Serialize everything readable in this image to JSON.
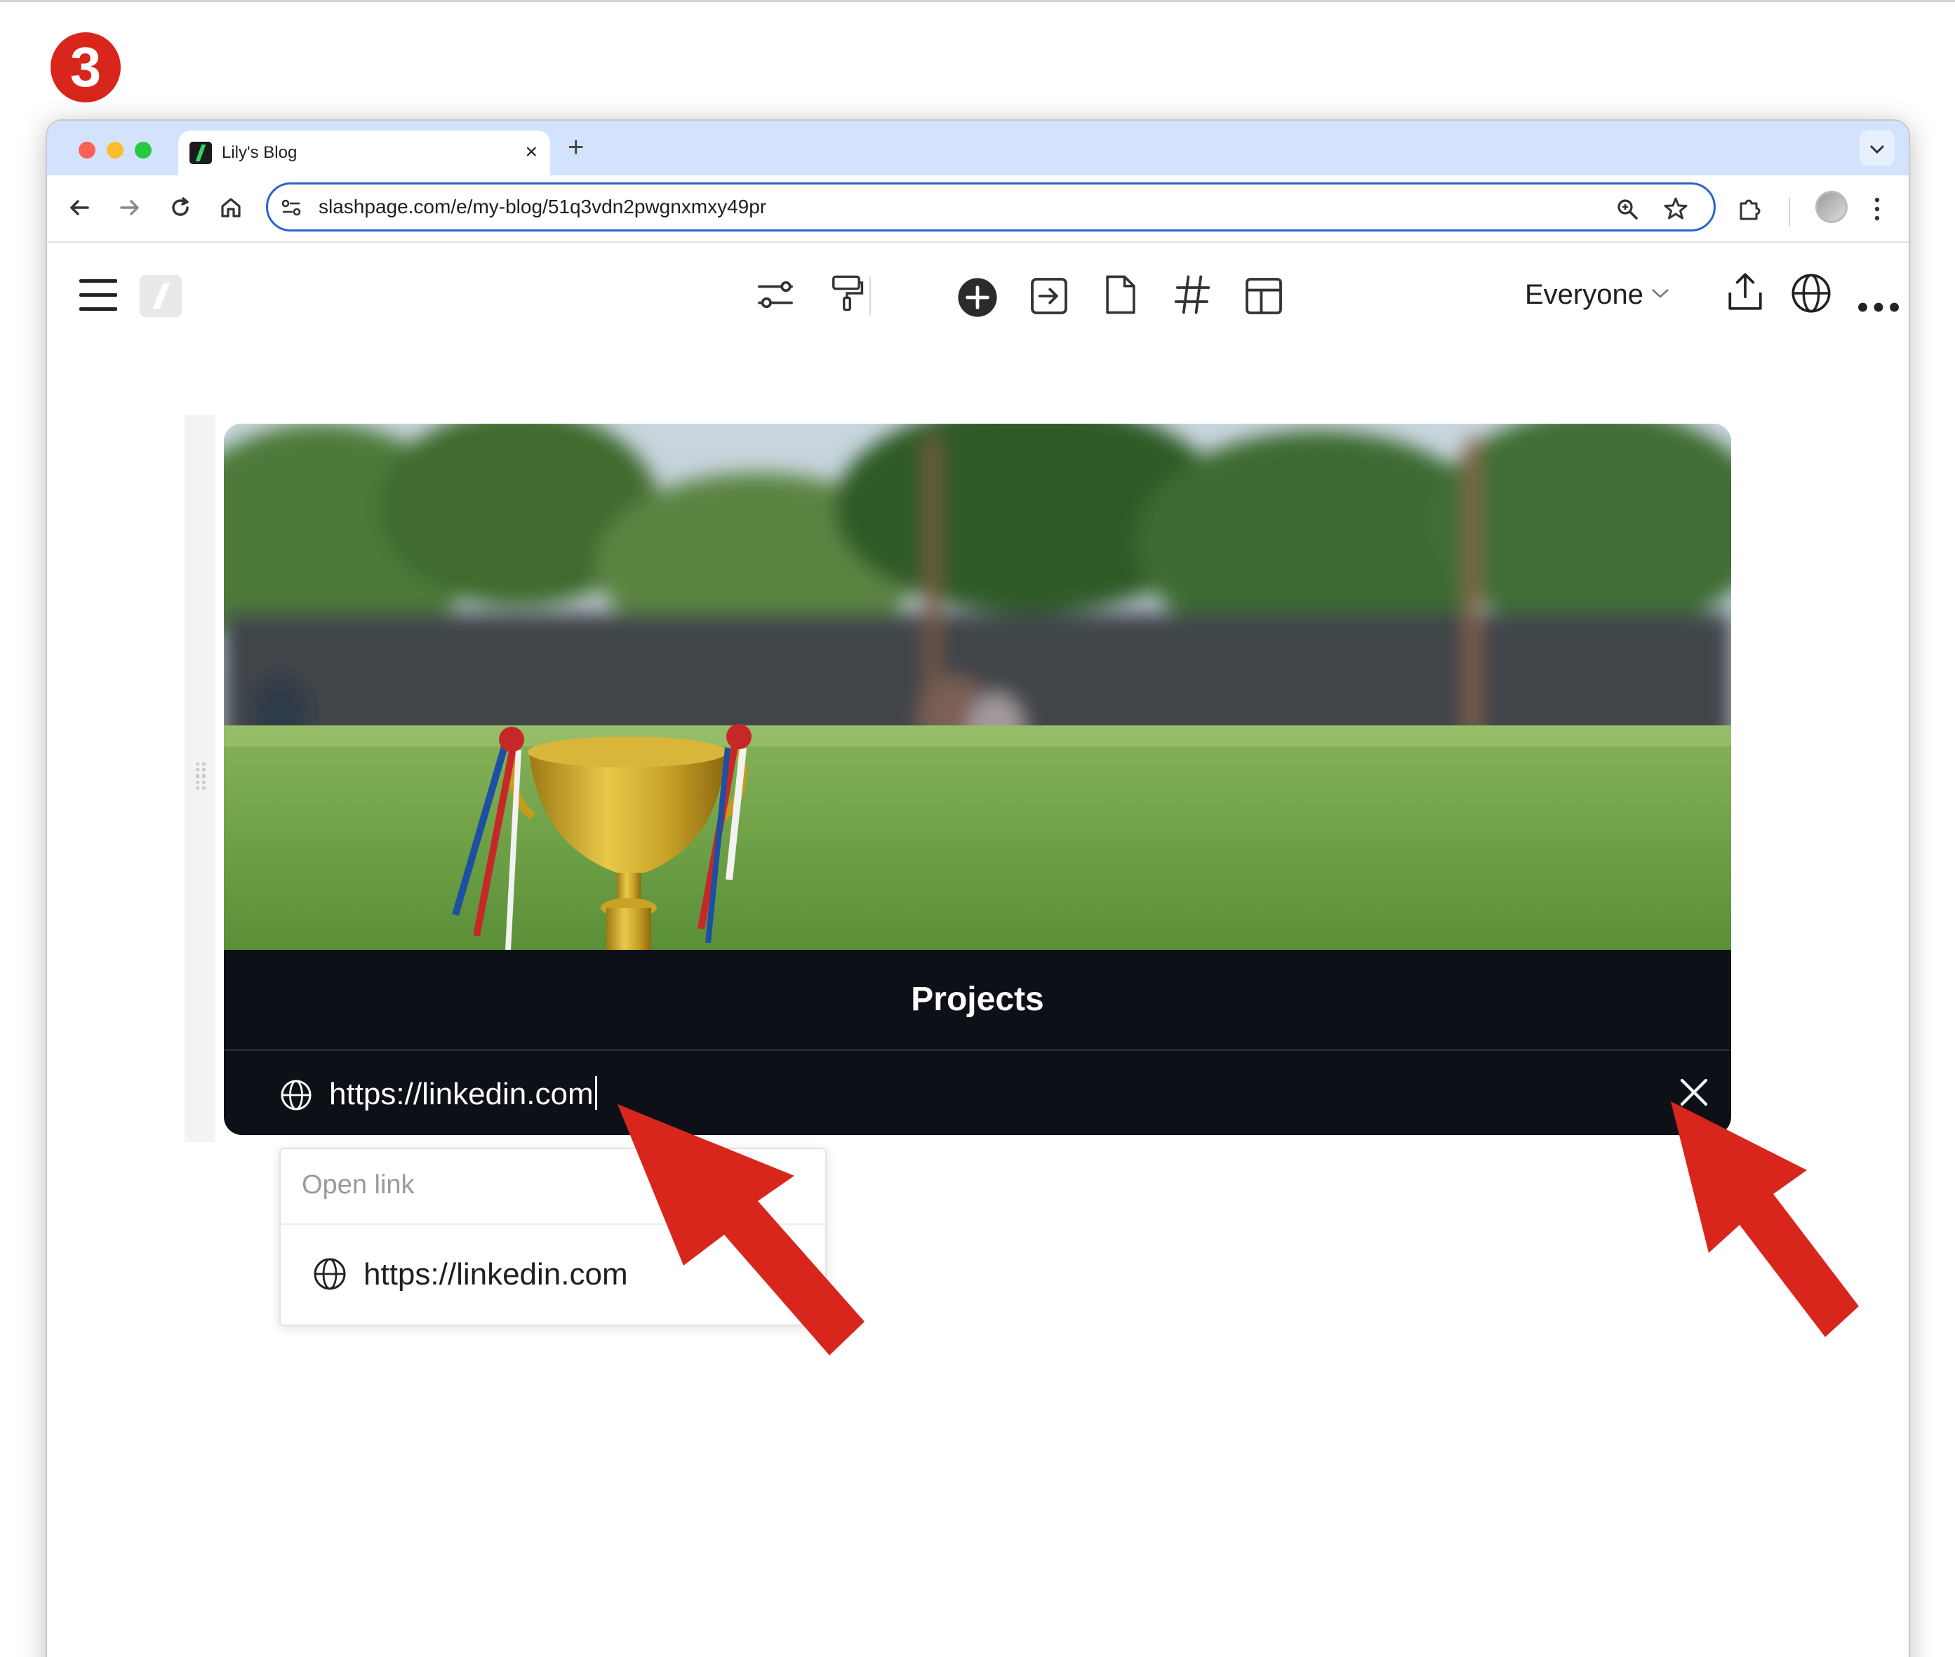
{
  "step": {
    "number": "3"
  },
  "browser": {
    "tab": {
      "title": "Lily's Blog",
      "close": "×"
    },
    "new_tab": "+",
    "tab_menu": "⌄",
    "address": "slashpage.com/e/my-blog/51q3vdn2pwgnxmxy49pr"
  },
  "app_toolbar": {
    "visibility_label": "Everyone",
    "visibility_chevron": "⌄",
    "hashtag": "#"
  },
  "cover": {
    "title": "Projects",
    "link_value": "https://linkedin.com"
  },
  "link_popup": {
    "header": "Open link",
    "item_url": "https://linkedin.com"
  },
  "colors": {
    "accent_blue": "#2a64c9",
    "tabbar": "#d3e3fd",
    "annotation_red": "#d8261c",
    "card_bg": "#0d1117"
  },
  "icons": [
    "back-icon",
    "forward-icon",
    "reload-icon",
    "home-icon",
    "site-settings-icon",
    "zoom-icon",
    "star-icon",
    "extensions-icon",
    "kebab-icon",
    "hamburger-icon",
    "filter-icon",
    "paint-roller-icon",
    "plus-circle-icon",
    "export-icon",
    "page-icon",
    "hashtag-icon",
    "layout-icon",
    "share-icon",
    "globe-icon",
    "more-icon",
    "close-icon"
  ]
}
